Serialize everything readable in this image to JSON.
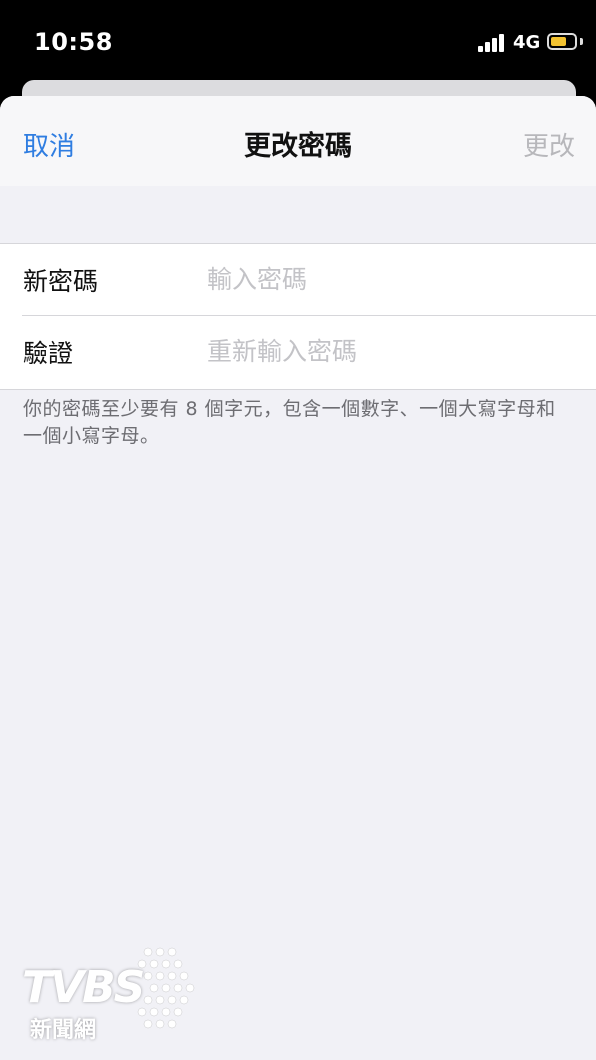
{
  "status_bar": {
    "time": "10:58",
    "network": "4G",
    "battery_level": 0.7,
    "battery_color": "#f2c230"
  },
  "navbar": {
    "cancel_label": "取消",
    "title": "更改密碼",
    "confirm_label": "更改"
  },
  "form": {
    "new_password": {
      "label": "新密碼",
      "placeholder": "輸入密碼",
      "value": ""
    },
    "verify": {
      "label": "驗證",
      "placeholder": "重新輸入密碼",
      "value": ""
    }
  },
  "footer_note": "你的密碼至少要有 8 個字元，包含一個數字、一個大寫字母和一個小寫字母。",
  "watermark": {
    "logo": "TVBS",
    "subtitle": "新聞網"
  },
  "colors": {
    "accent": "#2f7de1",
    "disabled": "#b7b7bb",
    "background": "#f1f1f6"
  }
}
